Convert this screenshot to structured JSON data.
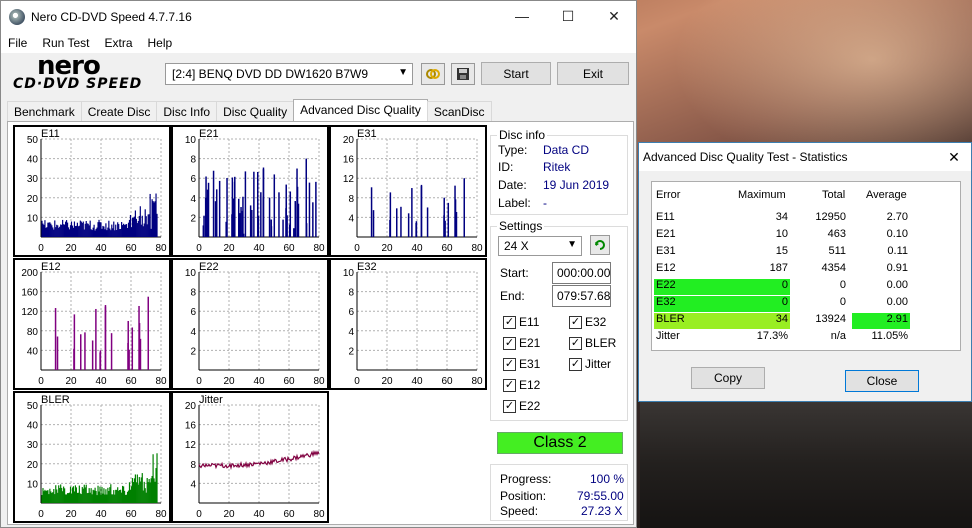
{
  "window": {
    "title": "Nero CD-DVD Speed 4.7.7.16",
    "minimize_glyph": "—",
    "maximize_glyph": "☐",
    "close_glyph": "✕"
  },
  "menu": [
    "File",
    "Run Test",
    "Extra",
    "Help"
  ],
  "logo": {
    "top": "nero",
    "bottom": "CD·DVD SPEED"
  },
  "toolbar": {
    "drive": "[2:4]   BENQ DVD DD DW1620 B7W9",
    "start_label": "Start",
    "exit_label": "Exit"
  },
  "tabs": [
    "Benchmark",
    "Create Disc",
    "Disc Info",
    "Disc Quality",
    "Advanced Disc Quality",
    "ScanDisc"
  ],
  "active_tab": "Advanced Disc Quality",
  "disc_info": {
    "title": "Disc info",
    "type_label": "Type:",
    "type": "Data CD",
    "id_label": "ID:",
    "id": "Ritek",
    "date_label": "Date:",
    "date": "19 Jun 2019",
    "label_label": "Label:",
    "label": "-"
  },
  "settings": {
    "title": "Settings",
    "speed": "24 X",
    "start_label": "Start:",
    "start": "000:00.00",
    "end_label": "End:",
    "end": "079:57.68",
    "checks": {
      "e11": "E11",
      "e21": "E21",
      "e31": "E31",
      "e12": "E12",
      "e22": "E22",
      "e32": "E32",
      "bler": "BLER",
      "jitter": "Jitter"
    }
  },
  "class_label": "Class 2",
  "progress": {
    "progress_label": "Progress:",
    "progress": "100 %",
    "position_label": "Position:",
    "position": "79:55.00",
    "speed_label": "Speed:",
    "speed": "27.23 X"
  },
  "charts": {
    "e11": {
      "label": "E11",
      "yticks": [
        "50",
        "40",
        "30",
        "20",
        "10"
      ],
      "xticks": [
        "0",
        "20",
        "40",
        "60",
        "80"
      ]
    },
    "e21": {
      "label": "E21",
      "yticks": [
        "10",
        "8",
        "6",
        "4",
        "2"
      ],
      "xticks": [
        "0",
        "20",
        "40",
        "60",
        "80"
      ]
    },
    "e31": {
      "label": "E31",
      "yticks": [
        "20",
        "16",
        "12",
        "8",
        "4"
      ],
      "xticks": [
        "0",
        "20",
        "40",
        "60",
        "80"
      ]
    },
    "e12": {
      "label": "E12",
      "yticks": [
        "200",
        "160",
        "120",
        "80",
        "40"
      ],
      "xticks": [
        "0",
        "20",
        "40",
        "60",
        "80"
      ]
    },
    "e22": {
      "label": "E22",
      "yticks": [
        "10",
        "8",
        "6",
        "4",
        "2"
      ],
      "xticks": [
        "0",
        "20",
        "40",
        "60",
        "80"
      ]
    },
    "e32": {
      "label": "E32",
      "yticks": [
        "10",
        "8",
        "6",
        "4",
        "2"
      ],
      "xticks": [
        "0",
        "20",
        "40",
        "60",
        "80"
      ]
    },
    "bler": {
      "label": "BLER",
      "yticks": [
        "50",
        "40",
        "30",
        "20",
        "10"
      ],
      "xticks": [
        "0",
        "20",
        "40",
        "60",
        "80"
      ]
    },
    "jitter": {
      "label": "Jitter",
      "yticks": [
        "20",
        "16",
        "12",
        "8",
        "4"
      ],
      "xticks": [
        "0",
        "20",
        "40",
        "60",
        "80"
      ]
    }
  },
  "colors": {
    "bars": "#000080",
    "e12_bars": "#800080",
    "bler": "#008000",
    "jitter": "#800040",
    "grid": "#b0b0b0"
  },
  "stats": {
    "title": "Advanced Disc Quality Test - Statistics",
    "headers": {
      "error": "Error",
      "max": "Maximum",
      "total": "Total",
      "avg": "Average"
    },
    "rows": [
      {
        "error": "E11",
        "max": "34",
        "total": "12950",
        "avg": "2.70"
      },
      {
        "error": "E21",
        "max": "10",
        "total": "463",
        "avg": "0.10"
      },
      {
        "error": "E31",
        "max": "15",
        "total": "511",
        "avg": "0.11"
      },
      {
        "error": "E12",
        "max": "187",
        "total": "4354",
        "avg": "0.91"
      },
      {
        "error": "E22",
        "max": "0",
        "total": "0",
        "avg": "0.00"
      },
      {
        "error": "E32",
        "max": "0",
        "total": "0",
        "avg": "0.00"
      },
      {
        "error": "BLER",
        "max": "34",
        "total": "13924",
        "avg": "2.91"
      },
      {
        "error": "Jitter",
        "max": "17.3%",
        "total": "n/a",
        "avg": "11.05%"
      }
    ],
    "copy_label": "Copy",
    "close_label": "Close"
  }
}
